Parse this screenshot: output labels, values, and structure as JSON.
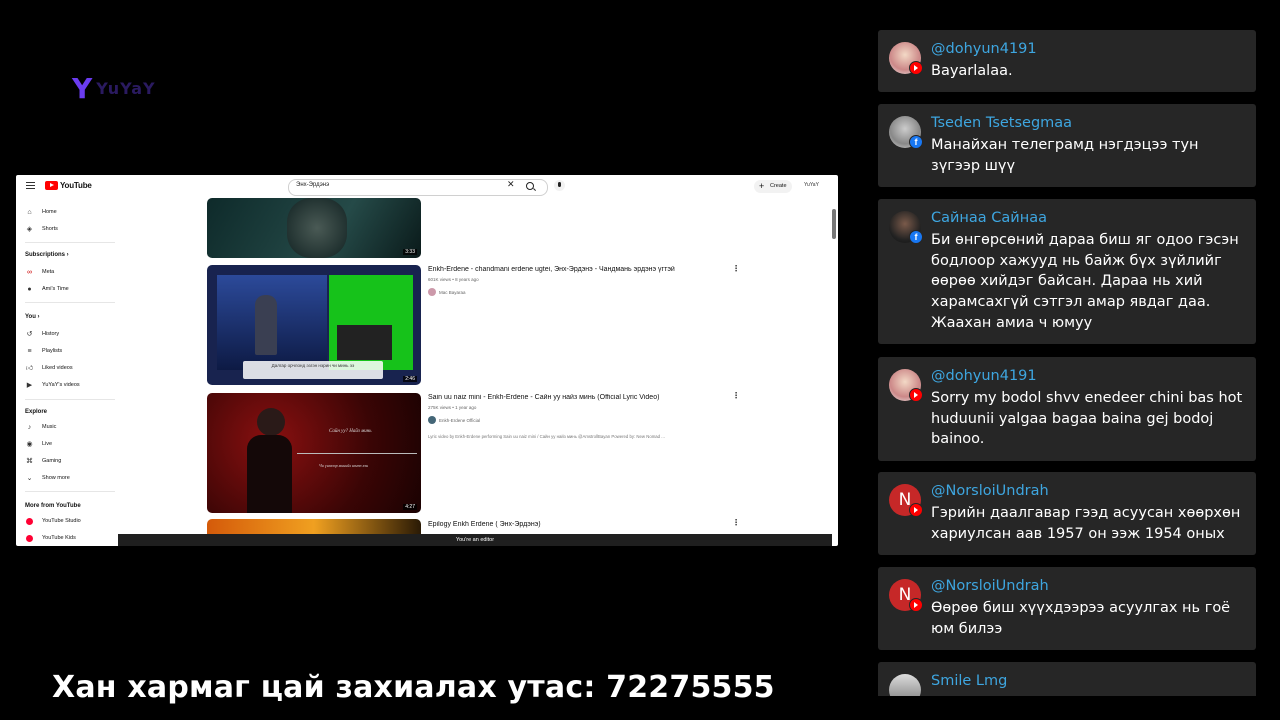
{
  "overlay": {
    "logo_mark": "Y",
    "logo_text": "YuYaY",
    "banner": "Хан хармаг цай захиалах утас: 72275555"
  },
  "youtube": {
    "brand": "YouTube",
    "search_value": "Энх-Эрдэнэ",
    "create_label": "Create",
    "account_label": "YuYaY",
    "sidebar": {
      "home": "Home",
      "shorts": "Shorts",
      "subscriptions_header": "Subscriptions",
      "sub_meta": "Meta",
      "sub_amis": "Ami's Time",
      "you_header": "You",
      "history": "History",
      "playlists": "Playlists",
      "liked": "Liked videos",
      "your_videos": "YuYaY's videos",
      "explore_header": "Explore",
      "music": "Music",
      "live": "Live",
      "gaming": "Gaming",
      "show_more": "Show more",
      "more_header": "More from YouTube",
      "studio": "YouTube Studio",
      "kids": "YouTube Kids"
    },
    "videos": [
      {
        "duration": "3:33"
      },
      {
        "title": "Enkh-Erdene - chandmani erdene ugtei, Энх-Эрдэнэ - Чандмань эрдэнэ үгтэй",
        "meta": "601K views • 8 years ago",
        "channel": "Mac Bayaraa",
        "duration": "2:46",
        "thumb_caption": "Далгар орчлонд эзгэн нэрин чи минь ээ"
      },
      {
        "title": "Sain uu naiz mini - Enkh-Erdene - Сайн уу найз минь (Official Lyric Video)",
        "meta": "275K views • 1 year ago",
        "channel": "Enkh-Erdene Official",
        "desc": "Lyric video by Enkh-Erdene performing Sain uu naiz mini / Сайн уу найз минь @AmstrollBayan Powered by: New Nomad ...",
        "duration": "4:27",
        "thumb_text": "Сайн уу? Найз минь",
        "thumb_sub": "Чи үнэхээр минийх нөгөө хэн"
      },
      {
        "title": "Epilogy Enkh Erdene ( Энх-Эрдэнэ)"
      }
    ],
    "editor_bar": "You're an editor"
  },
  "chat": [
    {
      "user": "@dohyun4191",
      "text": "Bayarlalaa.",
      "platform": "youtube"
    },
    {
      "user": "Tseden Tsetsegmaa",
      "text": "Манайхан телеграмд нэгдэцээ тун зүгээр шүү",
      "platform": "facebook"
    },
    {
      "user": "Сайнаа Сайнаа",
      "text": "Би өнгөрсөний дараа биш яг одоо гэсэн бодлоор хажууд нь байж бүх зүйлийг өөрөө хийдэг байсан. Дараа нь хий харамсахгүй сэтгэл амар явдаг даа. Жаахан амиа ч юмуу",
      "platform": "facebook"
    },
    {
      "user": "@dohyun4191",
      "text": "Sorry my bodol shvv enedeer chini bas hot huduunii yalgaa bagaa baina gej bodoj bainoo.",
      "platform": "youtube"
    },
    {
      "user": "@NorsloiUndrah",
      "initial": "N",
      "text": "Гэрийн даалгавар гээд асуусан хөөрхөн хариулсан аав 1957 он ээж 1954 оных",
      "platform": "youtube"
    },
    {
      "user": "@NorsloiUndrah",
      "initial": "N",
      "text": "Өөрөө биш хүүхдээрээ асуулгах нь гоё юм билээ",
      "platform": "youtube"
    },
    {
      "user": "Smile Lmg",
      "text": "",
      "platform": "youtube"
    }
  ],
  "colors": {
    "username": "#3ea6e0",
    "card_bg": "#262626",
    "youtube_red": "#ff0000",
    "facebook_blue": "#1877f2"
  }
}
